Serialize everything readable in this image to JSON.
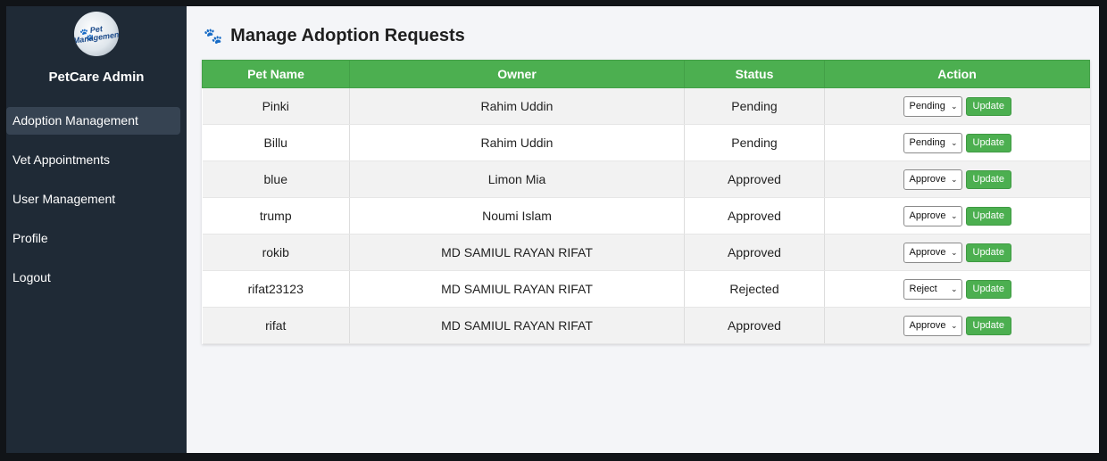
{
  "sidebar": {
    "logo_text": "Pet Management",
    "brand": "PetCare Admin",
    "items": [
      {
        "label": "Adoption Management"
      },
      {
        "label": "Vet Appointments"
      },
      {
        "label": "User Management"
      },
      {
        "label": "Profile"
      },
      {
        "label": "Logout"
      }
    ]
  },
  "main": {
    "title": "Manage Adoption Requests",
    "title_icon": "paw-icon",
    "headers": {
      "pet": "Pet Name",
      "owner": "Owner",
      "status": "Status",
      "action": "Action"
    },
    "update_label": "Update",
    "rows": [
      {
        "pet": "Pinki",
        "owner": "Rahim Uddin",
        "status": "Pending",
        "select": "Pending"
      },
      {
        "pet": "Billu",
        "owner": "Rahim Uddin",
        "status": "Pending",
        "select": "Pending"
      },
      {
        "pet": "blue",
        "owner": "Limon Mia",
        "status": "Approved",
        "select": "Approve"
      },
      {
        "pet": "trump",
        "owner": "Noumi Islam",
        "status": "Approved",
        "select": "Approve"
      },
      {
        "pet": "rokib",
        "owner": "MD SAMIUL RAYAN RIFAT",
        "status": "Approved",
        "select": "Approve"
      },
      {
        "pet": "rifat23123",
        "owner": "MD SAMIUL RAYAN RIFAT",
        "status": "Rejected",
        "select": "Reject"
      },
      {
        "pet": "rifat",
        "owner": "MD SAMIUL RAYAN RIFAT",
        "status": "Approved",
        "select": "Approve"
      }
    ]
  },
  "colors": {
    "accent": "#4caf50",
    "sidebar": "#1f2a36",
    "active_item": "#364352"
  }
}
